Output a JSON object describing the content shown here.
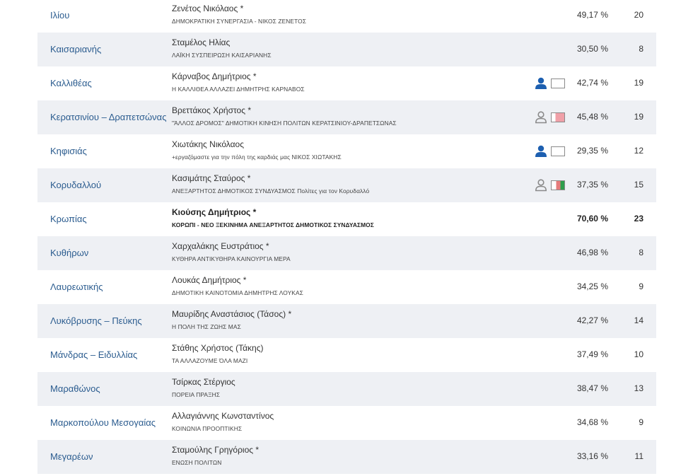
{
  "rows": [
    {
      "municipality": "Ιλίου",
      "candidate": "Ζενέτος Νικόλαος *",
      "party": "ΔΗΜΟΚΡΑΤΙΚΗ ΣΥΝΕΡΓΑΣΙΑ - ΝΙΚΟΣ ΖΕΝΕΤΟΣ",
      "percent": "49,17 %",
      "seats": "20"
    },
    {
      "municipality": "Καισαριανής",
      "candidate": "Σταμέλος Ηλίας",
      "party": "ΛΑΪΚΗ ΣΥΣΠΕΙΡΩΣΗ ΚΑΙΣΑΡΙΑΝΗΣ",
      "percent": "30,50 %",
      "seats": "8"
    },
    {
      "municipality": "Καλλιθέας",
      "candidate": "Κάρναβος Δημήτριος *",
      "party": "Η ΚΑΛΛΙΘΕΑ ΑΛΛΑΖΕΙ ΔΗΜΗΤΡΗΣ ΚΑΡΝΑΒΟΣ",
      "percent": "42,74 %",
      "seats": "19",
      "person_icon": "person-filled-icon",
      "flag_icon": "flag-blank-icon"
    },
    {
      "municipality": "Κερατσινίου – Δραπετσώνας",
      "candidate": "Βρεττάκος Χρήστος *",
      "party": "\"ΆΛΛΟΣ ΔΡΟΜΟΣ\" ΔΗΜΟΤΙΚΗ ΚΙΝΗΣΗ ΠΟΛΙΤΩΝ ΚΕΡΑΤΣΙΝΙΟΥ-ΔΡΑΠΕΤΣΩΝΑΣ",
      "percent": "45,48 %",
      "seats": "19",
      "person_icon": "person-outline-icon",
      "flag_icon": "flag-red-white-icon"
    },
    {
      "municipality": "Κηφισιάς",
      "candidate": "Χιωτάκης Νικόλαος",
      "party": "+εργαζόμαστε για την πόλη της καρδιάς μας ΝΙΚΟΣ ΧΙΩΤΑΚΗΣ",
      "percent": "29,35 %",
      "seats": "12",
      "person_icon": "person-filled-icon",
      "flag_icon": "flag-blank-icon"
    },
    {
      "municipality": "Κορυδαλλού",
      "candidate": "Κασιμάτης Σταύρος *",
      "party": "ΑΝΕΞΑΡΤΗΤΟΣ ΔΗΜΟΤΙΚΟΣ ΣΥΝΔΥΑΣΜΟΣ Πολίτες για τον Κορυδαλλό",
      "percent": "37,35 %",
      "seats": "15",
      "person_icon": "person-outline-icon",
      "flag_icon": "flag-tricolor-icon"
    },
    {
      "municipality": "Κρωπίας",
      "candidate": "Κιούσης Δημήτριος *",
      "party": "ΚΟΡΩΠΙ - ΝΕΟ ΞΕΚΙΝΗΜΑ ΑΝΕΞΑΡΤΗΤΟΣ ΔΗΜΟΤΙΚΟΣ ΣΥΝΔΥΑΣΜΟΣ",
      "percent": "70,60 %",
      "seats": "23",
      "bold": true
    },
    {
      "municipality": "Κυθήρων",
      "candidate": "Χαρχαλάκης Ευστράτιος *",
      "party": "ΚΥΘΗΡΑ ΑΝΤΙΚΥΘΗΡΑ ΚΑΙΝΟΥΡΓΙΑ ΜΕΡΑ",
      "percent": "46,98 %",
      "seats": "8"
    },
    {
      "municipality": "Λαυρεωτικής",
      "candidate": "Λουκάς Δημήτριος *",
      "party": "ΔΗΜΟΤΙΚΗ ΚΑΙΝΟΤΟΜΙΑ ΔΗΜΗΤΡΗΣ ΛΟΥΚΑΣ",
      "percent": "34,25 %",
      "seats": "9"
    },
    {
      "municipality": "Λυκόβρυσης – Πεύκης",
      "candidate": "Μαυρίδης Αναστάσιος (Τάσος) *",
      "party": "Η ΠΟΛΗ ΤΗΣ ΖΩΗΣ ΜΑΣ",
      "percent": "42,27 %",
      "seats": "14"
    },
    {
      "municipality": "Μάνδρας – Ειδυλλίας",
      "candidate": "Στάθης Χρήστος (Τάκης)",
      "party": "ΤΑ ΑΛΛΑΖΟΥΜΕ ΌΛΑ ΜΑΖΙ",
      "percent": "37,49 %",
      "seats": "10"
    },
    {
      "municipality": "Μαραθώνος",
      "candidate": "Τσίρκας Στέργιος",
      "party": "ΠΟΡΕΙΑ ΠΡΑΞΗΣ",
      "percent": "38,47 %",
      "seats": "13"
    },
    {
      "municipality": "Μαρκοπούλου Μεσογαίας",
      "candidate": "Αλλαγιάννης Κωνσταντίνος",
      "party": "ΚΟΙΝΩΝΙΑ ΠΡΟΟΠΤΙΚΗΣ",
      "percent": "34,68 %",
      "seats": "9"
    },
    {
      "municipality": "Μεγαρέων",
      "candidate": "Σταμούλης Γρηγόριος *",
      "party": "ΕΝΩΣΗ ΠΟΛΙΤΩΝ",
      "percent": "33,16 %",
      "seats": "11"
    }
  ],
  "colors": {
    "link": "#2b5c8f",
    "alt_row": "#eef0f4",
    "person_filled": "#1d5fb0",
    "person_outline": "#8a8a8a"
  }
}
